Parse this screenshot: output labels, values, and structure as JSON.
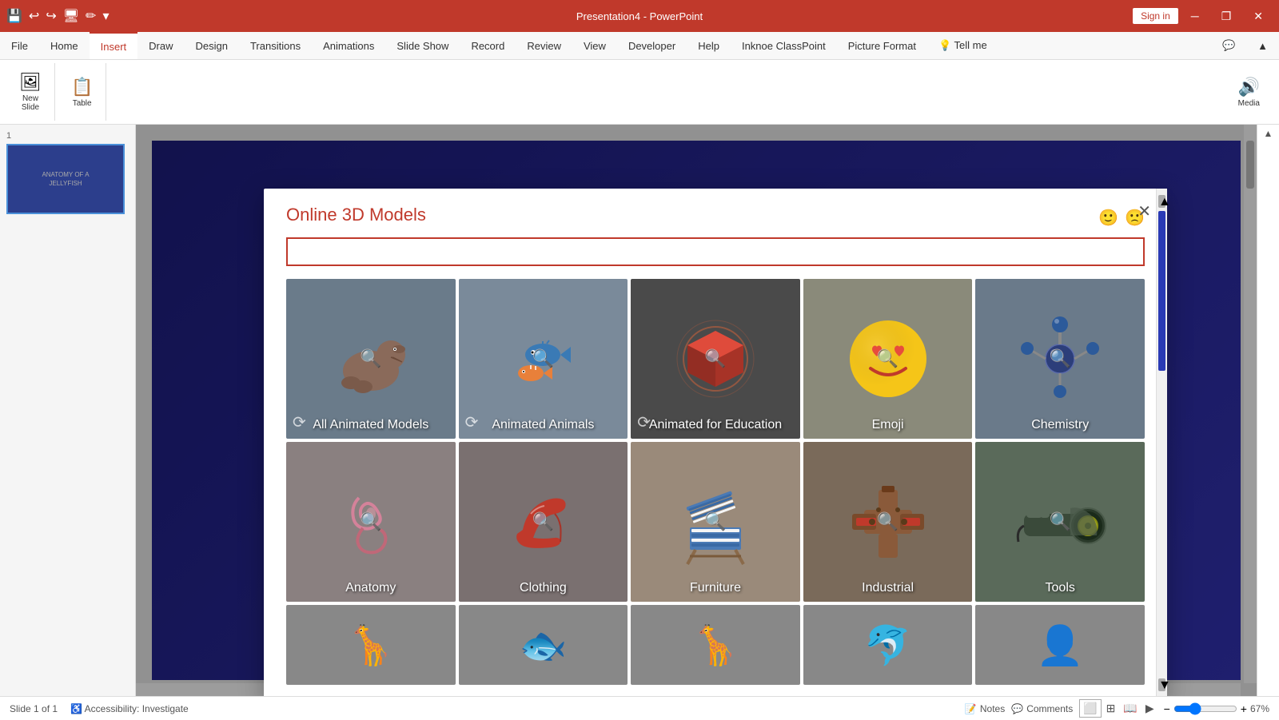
{
  "titleBar": {
    "appName": "Presentation4 - PowerPoint",
    "signInLabel": "Sign in",
    "windowControls": [
      "─",
      "❐",
      "✕"
    ]
  },
  "quickAccess": {
    "icons": [
      "💾",
      "↩",
      "↪",
      "🖥",
      "✏"
    ]
  },
  "ribbon": {
    "tabs": [
      {
        "label": "File",
        "active": false
      },
      {
        "label": "Home",
        "active": false
      },
      {
        "label": "Insert",
        "active": true
      },
      {
        "label": "Draw",
        "active": false
      },
      {
        "label": "Design",
        "active": false
      },
      {
        "label": "Transitions",
        "active": false
      },
      {
        "label": "Animations",
        "active": false
      },
      {
        "label": "Slide Show",
        "active": false
      },
      {
        "label": "Record",
        "active": false
      },
      {
        "label": "Review",
        "active": false
      },
      {
        "label": "View",
        "active": false
      },
      {
        "label": "Developer",
        "active": false
      },
      {
        "label": "Help",
        "active": false
      },
      {
        "label": "Inknoe ClassPoint",
        "active": false
      },
      {
        "label": "Picture Format",
        "active": false
      },
      {
        "label": "💡 Tell me",
        "active": false
      }
    ],
    "groups": [
      {
        "buttons": [
          {
            "icon": "🖼",
            "label": "New\nSlide"
          },
          {
            "icon": "📋",
            "label": "Table"
          }
        ]
      }
    ],
    "mediaLabel": "Media"
  },
  "slidePanel": {
    "slideNumber": "1",
    "slideTitle": "ANATOMY OF A\nJELLYFISH"
  },
  "modal": {
    "title": "Online 3D Models",
    "searchPlaceholder": "",
    "closeLabel": "✕",
    "thumbsUpIcon": "🙂",
    "thumbsDownIcon": "🙁",
    "categories": [
      {
        "label": "All Animated Models",
        "bgColor": "#6a7b8a",
        "emoji": "🦖",
        "hasAnimIcon": true,
        "row": 1
      },
      {
        "label": "Animated Animals",
        "bgColor": "#7a8c9a",
        "emoji": "🐠",
        "hasAnimIcon": true,
        "row": 1
      },
      {
        "label": "Animated for Education",
        "bgColor": "#5a5a5a",
        "emoji": "📦",
        "hasAnimIcon": true,
        "row": 1
      },
      {
        "label": "Emoji",
        "bgColor": "#7a8a7a",
        "emoji": "😍",
        "hasAnimIcon": false,
        "row": 1
      },
      {
        "label": "Chemistry",
        "bgColor": "#6a7a8a",
        "emoji": "⚗️",
        "hasAnimIcon": false,
        "row": 1
      },
      {
        "label": "Anatomy",
        "bgColor": "#8a8a8a",
        "emoji": "🫀",
        "hasAnimIcon": false,
        "row": 2
      },
      {
        "label": "Clothing",
        "bgColor": "#7a7a7a",
        "emoji": "👠",
        "hasAnimIcon": false,
        "row": 2
      },
      {
        "label": "Furniture",
        "bgColor": "#9a9a8a",
        "emoji": "🪑",
        "hasAnimIcon": false,
        "row": 2
      },
      {
        "label": "Industrial",
        "bgColor": "#7a6a5a",
        "emoji": "🔧",
        "hasAnimIcon": false,
        "row": 2
      },
      {
        "label": "Tools",
        "bgColor": "#5a6a5a",
        "emoji": "🔨",
        "hasAnimIcon": false,
        "row": 2
      },
      {
        "label": "",
        "bgColor": "#888888",
        "emoji": "🦒",
        "hasAnimIcon": false,
        "row": 3
      },
      {
        "label": "",
        "bgColor": "#888888",
        "emoji": "🐟",
        "hasAnimIcon": false,
        "row": 3
      },
      {
        "label": "",
        "bgColor": "#888888",
        "emoji": "🦒",
        "hasAnimIcon": false,
        "row": 3
      },
      {
        "label": "",
        "bgColor": "#888888",
        "emoji": "🐬",
        "hasAnimIcon": false,
        "row": 3
      },
      {
        "label": "",
        "bgColor": "#888888",
        "emoji": "👤",
        "hasAnimIcon": false,
        "row": 3
      }
    ]
  },
  "statusBar": {
    "slideInfo": "Slide 1 of 1",
    "accessibilityLabel": "Accessibility: Investigate",
    "notesLabel": "Notes",
    "commentsLabel": "Comments",
    "zoomLevel": "67%"
  }
}
